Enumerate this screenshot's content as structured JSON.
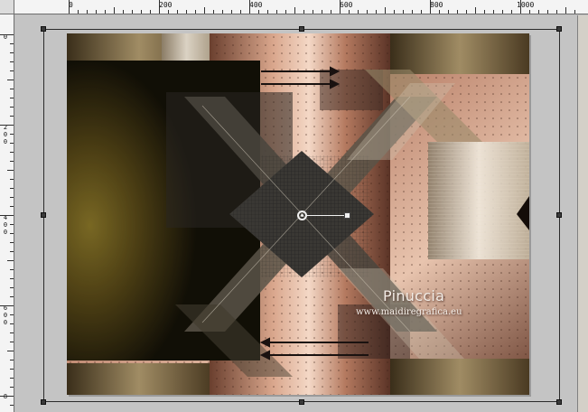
{
  "ruler_top": {
    "labels": [
      "0",
      "200",
      "400",
      "600",
      "800",
      "1000"
    ]
  },
  "ruler_left": {
    "labels": [
      [
        "0"
      ],
      [
        "2",
        "0",
        "0"
      ],
      [
        "4",
        "0",
        "0"
      ],
      [
        "6",
        "0",
        "0"
      ],
      [
        "8"
      ]
    ]
  },
  "canvas": {
    "watermark_title": "Pinuccia",
    "watermark_url": "www.maidiregrafica.eu"
  },
  "icons": {
    "pivot": "pivot-crosshair-icon",
    "rotate": "rotate-handle-icon",
    "arrows": "double-arrow-icon"
  },
  "colors": {
    "copper": "#b27a62",
    "olive": "#6b5a1e",
    "dark": "#141210",
    "workspace": "#c4c4c4"
  }
}
